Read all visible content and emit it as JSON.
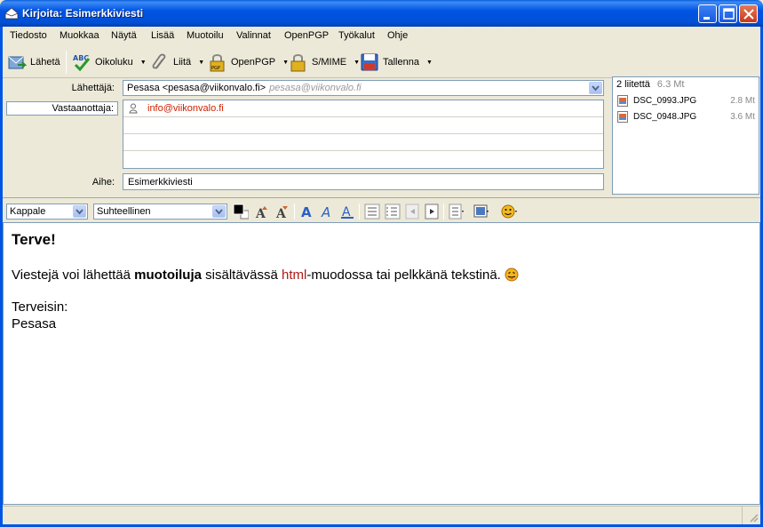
{
  "window": {
    "title": "Kirjoita: Esimerkkiviesti"
  },
  "menu": [
    "Tiedosto",
    "Muokkaa",
    "Näytä",
    "Lisää",
    "Muotoilu",
    "Valinnat",
    "OpenPGP",
    "Työkalut",
    "Ohje"
  ],
  "toolbar": {
    "send": "Lähetä",
    "spell": "Oikoluku",
    "attach": "Liitä",
    "openpgp": "OpenPGP",
    "smime": "S/MIME",
    "save": "Tallenna"
  },
  "header": {
    "from_label": "Lähettäjä:",
    "from_value": "Pesasa <pesasa@viikonvalo.fi>",
    "from_identity": "pesasa@viikonvalo.fi",
    "to_type": "Vastaanottaja:",
    "recipients": [
      "info@viikonvalo.fi"
    ],
    "subject_label": "Aihe:",
    "subject_value": "Esimerkkiviesti"
  },
  "attachments": {
    "count_label": "2 liitettä",
    "total_size": "6.3 Mt",
    "items": [
      {
        "name": "DSC_0993.JPG",
        "size": "2.8 Mt"
      },
      {
        "name": "DSC_0948.JPG",
        "size": "3.6 Mt"
      }
    ]
  },
  "format": {
    "paragraph": "Kappale",
    "font": "Suhteellinen"
  },
  "body": {
    "heading": "Terve!",
    "line1_a": "Viestejä voi lähettää ",
    "line1_bold": "muotoiluja",
    "line1_b": " sisältävässä ",
    "line1_red": "html",
    "line1_c": "-muodossa tai pelkkänä tekstinä.",
    "closing": "Terveisin:",
    "signature": "Pesasa"
  },
  "colors": {
    "titlebar": "#0054e3",
    "recipient": "#cc2200",
    "html_word": "#b01818"
  }
}
